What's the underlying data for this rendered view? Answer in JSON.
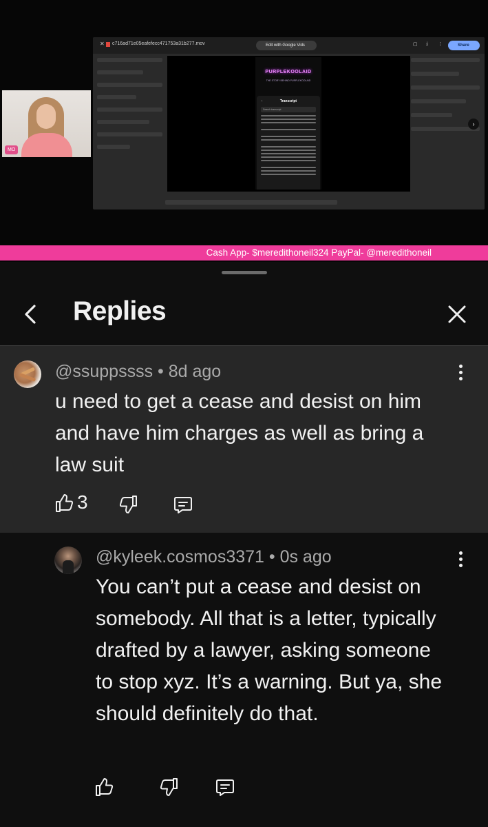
{
  "video": {
    "file_name": "c716ad71e05eafefecc471753a31b277.mov",
    "edit_button": "Edit with Google Vids",
    "share_button": "Share",
    "webcam_tag": "MO",
    "phone_brand": "PURPLEKOOLAID",
    "phone_subtitle": "THE STORY BEHIND PURPLEKOOLAID",
    "transcript_title": "Transcript",
    "transcript_search": "Search transcript",
    "banner": "Cash App- $meredithoneil324 PayPal- @meredithoneil"
  },
  "header": {
    "title": "Replies"
  },
  "parent_comment": {
    "author": "@ssuppssss",
    "age": "8d ago",
    "meta": "@ssuppssss • 8d ago",
    "text": "u need to get a cease and desist on him and have him charges as well as bring a law suit",
    "likes": "3"
  },
  "reply_comment": {
    "author": "@kyleek.cosmos3371",
    "age": "0s ago",
    "meta": "@kyleek.cosmos3371 • 0s ago",
    "text": "You can’t put a cease and desist on somebody. All that is a letter, typically drafted by a lawyer, asking someone to stop xyz. It’s a warning. But ya, she should definitely do that."
  },
  "colors": {
    "background": "#0f0f0f",
    "parent_highlight": "#272727",
    "meta_text": "#aaaaaa",
    "banner": "#ef3c9b"
  }
}
